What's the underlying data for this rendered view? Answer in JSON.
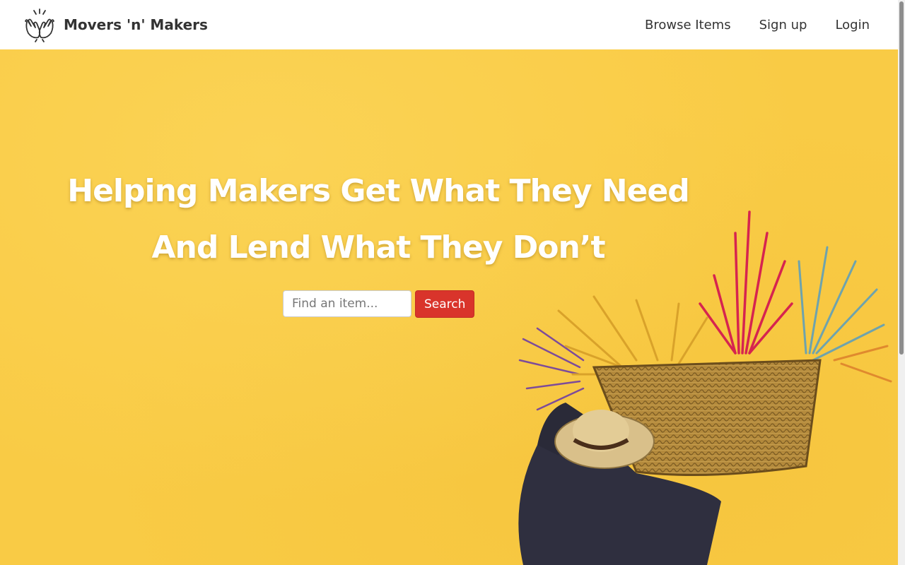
{
  "nav": {
    "brand_name": "Movers 'n' Makers",
    "links": [
      {
        "label": "Browse Items"
      },
      {
        "label": "Sign up"
      },
      {
        "label": "Login"
      }
    ]
  },
  "hero": {
    "title_line1": "Helping Makers Get What They Need",
    "title_line2": "And Lend What They Don’t",
    "search": {
      "placeholder": "Find an item...",
      "value": "",
      "button_label": "Search"
    }
  },
  "colors": {
    "background": "#f9cb45",
    "button": "#d9342b",
    "title": "#ffffff",
    "nav_text": "#333333"
  },
  "icons": {
    "logo": "high-five-hands-icon"
  }
}
